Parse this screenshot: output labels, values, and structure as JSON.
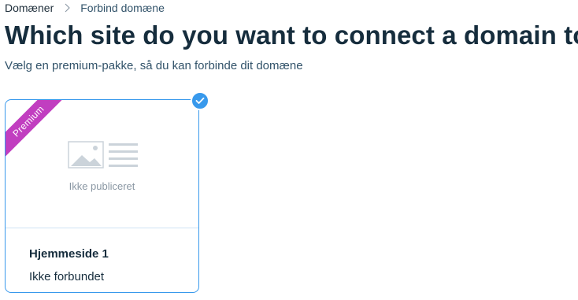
{
  "breadcrumb": {
    "items": [
      "Domæner",
      "Forbind domæne"
    ]
  },
  "header": {
    "title": "Which site do you want to connect a domain to?",
    "subtitle": "Vælg en premium-pakke, så du kan forbinde dit domæne"
  },
  "sites": [
    {
      "ribbon": "Premium",
      "preview_status": "Ikke publiceret",
      "name": "Hjemmeside 1",
      "connection_status": "Ikke forbundet",
      "selected": true
    }
  ],
  "colors": {
    "accent": "#3899ec",
    "premium_ribbon": "#c13ec0",
    "text_primary": "#162d3d",
    "text_muted": "#8a97a3"
  },
  "icons": {
    "breadcrumb_separator": "chevron-right-icon",
    "site_placeholder": "image-placeholder-icon",
    "selected_badge": "checkmark-icon"
  }
}
